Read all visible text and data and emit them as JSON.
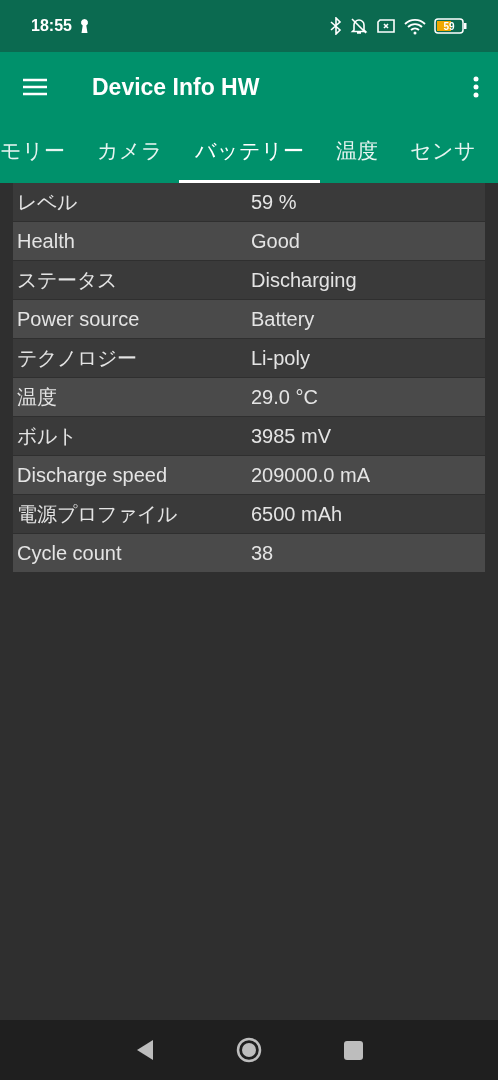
{
  "status_bar": {
    "time": "18:55",
    "battery_text": "59"
  },
  "app_bar": {
    "title": "Device Info HW"
  },
  "tabs": [
    {
      "label": "モリー",
      "selected": false
    },
    {
      "label": "カメラ",
      "selected": false
    },
    {
      "label": "バッテリー",
      "selected": true
    },
    {
      "label": "温度",
      "selected": false
    },
    {
      "label": "センサ",
      "selected": false
    }
  ],
  "rows": [
    {
      "label": "レベル",
      "value": "59 %"
    },
    {
      "label": "Health",
      "value": "Good"
    },
    {
      "label": "ステータス",
      "value": "Discharging"
    },
    {
      "label": "Power source",
      "value": "Battery"
    },
    {
      "label": "テクノロジー",
      "value": "Li-poly"
    },
    {
      "label": "温度",
      "value": "29.0 °C"
    },
    {
      "label": "ボルト",
      "value": "3985 mV"
    },
    {
      "label": "Discharge speed",
      "value": "209000.0 mA"
    },
    {
      "label": "電源プロファイル",
      "value": "6500 mAh"
    },
    {
      "label": "Cycle count",
      "value": "38"
    }
  ]
}
